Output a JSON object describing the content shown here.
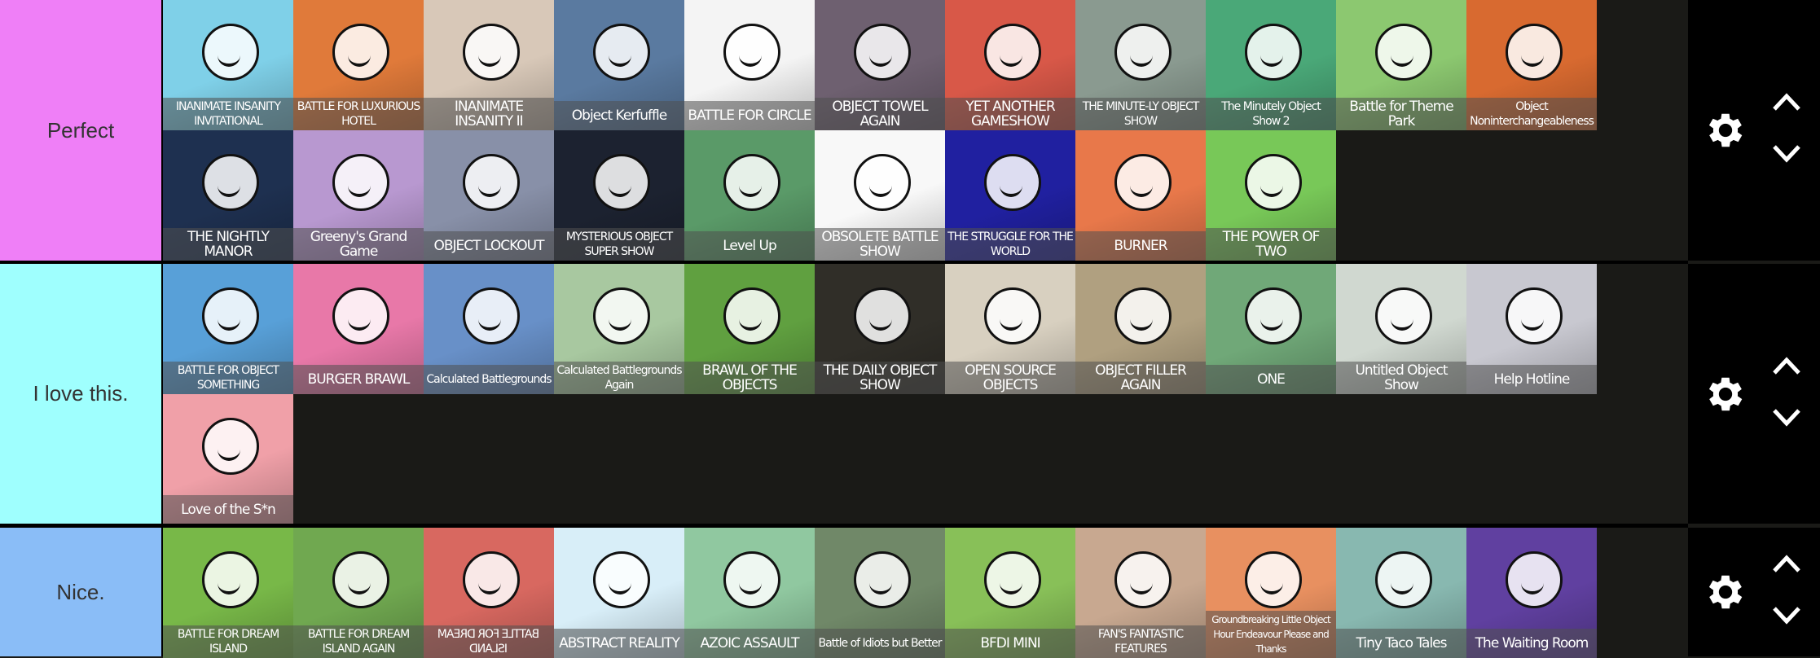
{
  "tiers": [
    {
      "label": "Perfect",
      "color": "#ef7ff7",
      "items": [
        {
          "caption": "INANIMATE INSANITY INVITATIONAL",
          "color": "#7fd0e8"
        },
        {
          "caption": "BATTLE FOR LUXURIOUS HOTEL",
          "color": "#e07a3a"
        },
        {
          "caption": "INANIMATE INSANITY II",
          "color": "#d8c8b8"
        },
        {
          "caption": "Object Kerfuffle",
          "color": "#5a7aa0"
        },
        {
          "caption": "BATTLE FOR CIRCLE",
          "color": "#f4f4f4"
        },
        {
          "caption": "OBJECT TOWEL AGAIN",
          "color": "#6e6070"
        },
        {
          "caption": "YET ANOTHER GAMESHOW",
          "color": "#d85848"
        },
        {
          "caption": "THE MINUTE-LY OBJECT SHOW",
          "color": "#8a9a90"
        },
        {
          "caption": "The Minutely Object Show 2",
          "color": "#4aa878"
        },
        {
          "caption": "Battle for Theme Park",
          "color": "#8cc870"
        },
        {
          "caption": "Object Noninterchangeableness",
          "color": "#d86a30"
        },
        {
          "caption": "THE NIGHTLY MANOR",
          "color": "#1e3050"
        },
        {
          "caption": "Greeny's Grand Game",
          "color": "#b898d0"
        },
        {
          "caption": "OBJECT LOCKOUT",
          "color": "#8890a8"
        },
        {
          "caption": "MYSTERIOUS OBJECT SUPER SHOW",
          "color": "#1c2230"
        },
        {
          "caption": "Level Up",
          "color": "#5a9a68"
        },
        {
          "caption": "OBSOLETE BATTLE SHOW",
          "color": "#f8f8f8"
        },
        {
          "caption": "THE STRUGGLE FOR THE WORLD",
          "color": "#2020a0"
        },
        {
          "caption": "BURNER",
          "color": "#e8784a"
        },
        {
          "caption": "THE POWER OF TWO",
          "color": "#78c858"
        }
      ]
    },
    {
      "label": "I love this.",
      "color": "#9ffffe",
      "items": [
        {
          "caption": "BATTLE FOR OBJECT SOMETHING",
          "color": "#58a0d8"
        },
        {
          "caption": "BURGER BRAWL",
          "color": "#e878a8"
        },
        {
          "caption": "Calculated Battlegrounds",
          "color": "#6890c8"
        },
        {
          "caption": "Calculated Battlegrounds Again",
          "color": "#a8c8a0"
        },
        {
          "caption": "BRAWL OF THE OBJECTS",
          "color": "#60a040"
        },
        {
          "caption": "THE DAILY OBJECT SHOW",
          "color": "#302e28"
        },
        {
          "caption": "OPEN SOURCE OBJECTS",
          "color": "#d8d0c0"
        },
        {
          "caption": "OBJECT FILLER AGAIN",
          "color": "#b0a080"
        },
        {
          "caption": "ONE",
          "color": "#70a878"
        },
        {
          "caption": "Untitled Object Show",
          "color": "#d0d8d0"
        },
        {
          "caption": "Help Hotline",
          "color": "#c8c8d0"
        },
        {
          "caption": "Love of the S*n",
          "color": "#f0a0a8"
        }
      ]
    },
    {
      "label": "Nice.",
      "color": "#8abdf7",
      "items": [
        {
          "caption": "BATTLE FOR DREAM ISLAND",
          "color": "#78b848"
        },
        {
          "caption": "BATTLE FOR DREAM ISLAND AGAIN",
          "color": "#70a850"
        },
        {
          "caption": "BATTLE FOR DREAM ISLAND",
          "color": "#d86860",
          "mirrored": true
        },
        {
          "caption": "ABSTRACT REALITY",
          "color": "#d8eef8"
        },
        {
          "caption": "AZOIC ASSAULT",
          "color": "#90c8a0"
        },
        {
          "caption": "Battle of Idiots but Better",
          "color": "#708868"
        },
        {
          "caption": "BFDI MINI",
          "color": "#88c058"
        },
        {
          "caption": "FAN'S FANTASTIC FEATURES",
          "color": "#c8a890"
        },
        {
          "caption": "Groundbreaking Little Object Hour Endeavour Please and Thanks",
          "color": "#e89060"
        },
        {
          "caption": "Tiny Taco Tales",
          "color": "#88b8b0"
        },
        {
          "caption": "The Waiting Room",
          "color": "#6040a0"
        }
      ]
    }
  ],
  "controls": {
    "settings_icon": "gear-icon",
    "up_icon": "chevron-up-icon",
    "down_icon": "chevron-down-icon"
  }
}
